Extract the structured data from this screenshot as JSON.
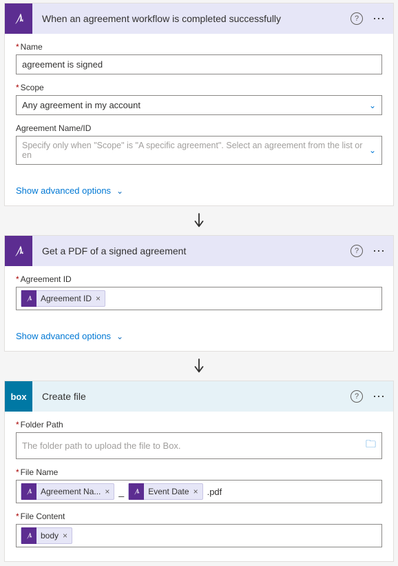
{
  "step1": {
    "title": "When an agreement workflow is completed successfully",
    "nameLabel": "Name",
    "nameValue": "agreement is signed",
    "scopeLabel": "Scope",
    "scopeValue": "Any agreement in my account",
    "agreementLabel": "Agreement Name/ID",
    "agreementPlaceholder": "Specify only when \"Scope\" is \"A specific agreement\". Select an agreement from the list or en",
    "showAdvanced": "Show advanced options"
  },
  "step2": {
    "title": "Get a PDF of a signed agreement",
    "agreementIdLabel": "Agreement ID",
    "agreementIdToken": "Agreement ID",
    "showAdvanced": "Show advanced options"
  },
  "step3": {
    "title": "Create file",
    "boxLabel": "box",
    "folderPathLabel": "Folder Path",
    "folderPathPlaceholder": "The folder path to upload the file to Box.",
    "fileNameLabel": "File Name",
    "fileNameToken1": "Agreement Na...",
    "fileNameSeparator": "_",
    "fileNameToken2": "Event Date",
    "fileNameSuffix": ".pdf",
    "fileContentLabel": "File Content",
    "fileContentToken": "body"
  }
}
